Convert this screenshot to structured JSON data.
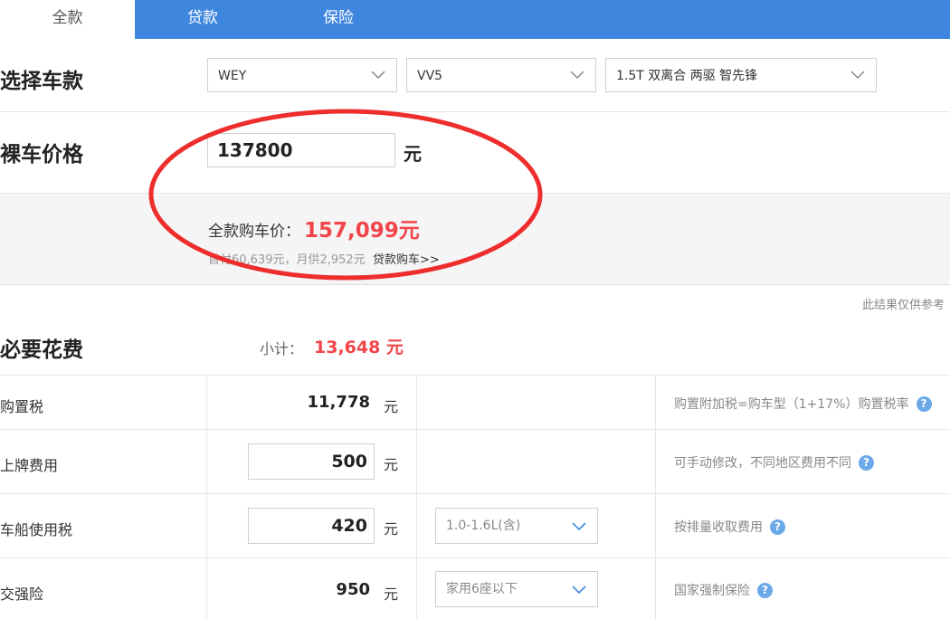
{
  "tabs": [
    {
      "label": "全款"
    },
    {
      "label": "贷款"
    },
    {
      "label": "保险"
    }
  ],
  "select_car": {
    "title": "选择车款",
    "brand": "WEY",
    "series": "VV5",
    "model": "1.5T 双离合 两驱 智先锋"
  },
  "bare_price": {
    "title": "裸车价格",
    "value": "137800",
    "unit": "元"
  },
  "total": {
    "label": "全款购车价：",
    "amount": "157,099元",
    "loan_summary": "首付60,639元，月供2,952元",
    "loan_link": "贷款购车>>"
  },
  "disclaimer": "此结果仅供参考",
  "required": {
    "title": "必要花费",
    "subtotal_label": "小计：",
    "subtotal_value": "13,648 元",
    "rows": [
      {
        "label": "购置税",
        "value": "11,778",
        "unit": "元",
        "hint": "购置附加税=购车型（1+17%）购置税率"
      },
      {
        "label": "上牌费用",
        "value": "500",
        "unit": "元",
        "hint": "可手动修改，不同地区费用不同"
      },
      {
        "label": "车船使用税",
        "value": "420",
        "unit": "元",
        "option": "1.0-1.6L(含)",
        "hint": "按排量收取费用"
      },
      {
        "label": "交强险",
        "value": "950",
        "unit": "元",
        "option": "家用6座以下",
        "hint": "国家强制保险"
      }
    ]
  },
  "colors": {
    "tab_bar": "#3f86de",
    "price_red": "#f2454a",
    "annotation_circle": "#ee2d2d",
    "help_icon": "#6aa8e8"
  },
  "icons": {
    "dropdown": "chevron-down-icon",
    "help": "question-circle-icon"
  }
}
